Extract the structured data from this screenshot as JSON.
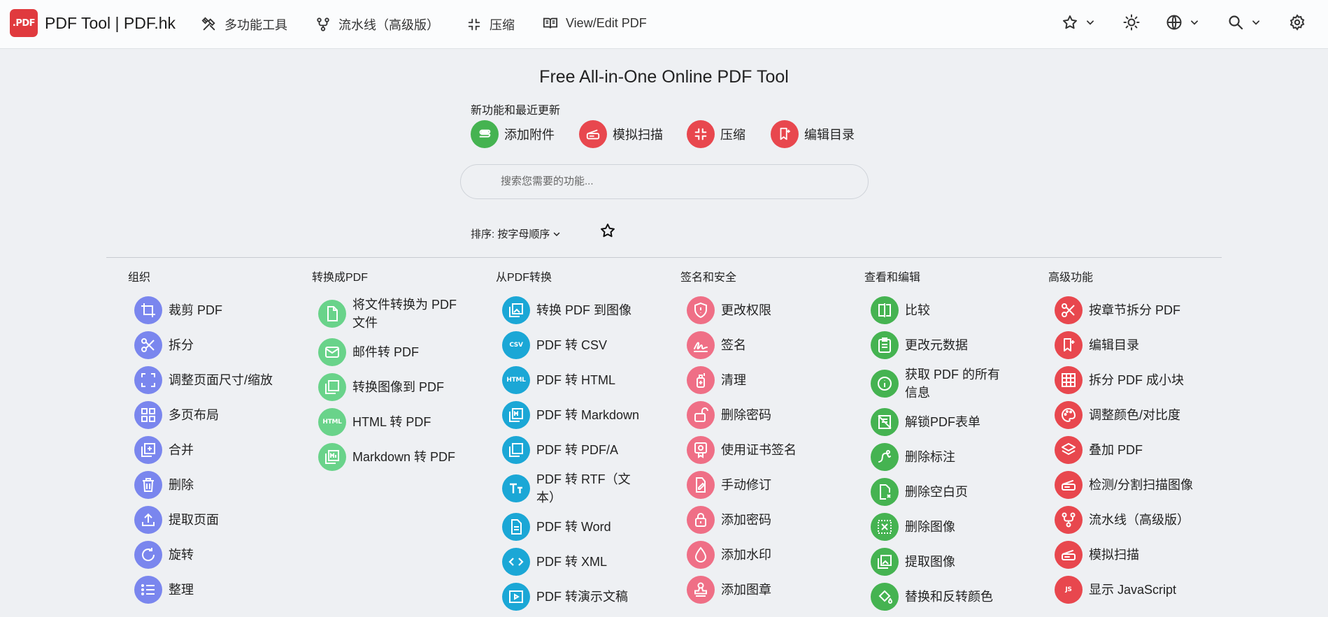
{
  "brand": {
    "logo_text": ".PDF",
    "name": "PDF Tool | PDF.hk"
  },
  "nav": {
    "multi_tool": "多功能工具",
    "pipeline": "流水线（高级版）",
    "compress": "压缩",
    "view_edit": "View/Edit PDF"
  },
  "hero": {
    "title": "Free All-in-One Online PDF Tool",
    "recent_label": "新功能和最近更新",
    "recent": [
      {
        "label": "添加附件",
        "color": "#45b351",
        "icon": "paperclip-icon"
      },
      {
        "label": "模拟扫描",
        "color": "#e8474e",
        "icon": "scanner-icon"
      },
      {
        "label": "压缩",
        "color": "#e8474e",
        "icon": "compress-icon"
      },
      {
        "label": "编辑目录",
        "color": "#e8474e",
        "icon": "bookmark-icon"
      }
    ],
    "search_placeholder": "搜索您需要的功能...",
    "sort_label": "排序: 按字母顺序"
  },
  "categories": [
    {
      "title": "组织",
      "color": "#7a86ee",
      "tools": [
        "裁剪 PDF",
        "拆分",
        "调整页面尺寸/缩放",
        "多页布局",
        "合并",
        "删除",
        "提取页面",
        "旋转",
        "整理"
      ]
    },
    {
      "title": "转换成PDF",
      "color": "#69d38a",
      "tools": [
        "将文件转换为 PDF 文件",
        "邮件转 PDF",
        "转换图像到 PDF",
        "HTML 转 PDF",
        "Markdown 转 PDF"
      ]
    },
    {
      "title": "从PDF转换",
      "color": "#1ba7d6",
      "tools": [
        "转换 PDF 到图像",
        "PDF 转 CSV",
        "PDF 转 HTML",
        "PDF 转 Markdown",
        "PDF 转 PDF/A",
        "PDF 转 RTF（文本）",
        "PDF 转 Word",
        "PDF 转 XML",
        "PDF 转演示文稿"
      ]
    },
    {
      "title": "签名和安全",
      "color": "#ef6f86",
      "tools": [
        "更改权限",
        "签名",
        "清理",
        "删除密码",
        "使用证书签名",
        "手动修订",
        "添加密码",
        "添加水印",
        "添加图章"
      ]
    },
    {
      "title": "查看和编辑",
      "color": "#45b351",
      "tools": [
        "比较",
        "更改元数据",
        "获取 PDF 的所有信息",
        "解锁PDF表单",
        "删除标注",
        "删除空白页",
        "删除图像",
        "提取图像",
        "替换和反转颜色"
      ]
    },
    {
      "title": "高级功能",
      "color": "#e8474e",
      "tools": [
        "按章节拆分 PDF",
        "编辑目录",
        "拆分 PDF 成小块",
        "调整颜色/对比度",
        "叠加 PDF",
        "检测/分割扫描图像",
        "流水线（高级版）",
        "模拟扫描",
        "显示 JavaScript"
      ]
    }
  ]
}
